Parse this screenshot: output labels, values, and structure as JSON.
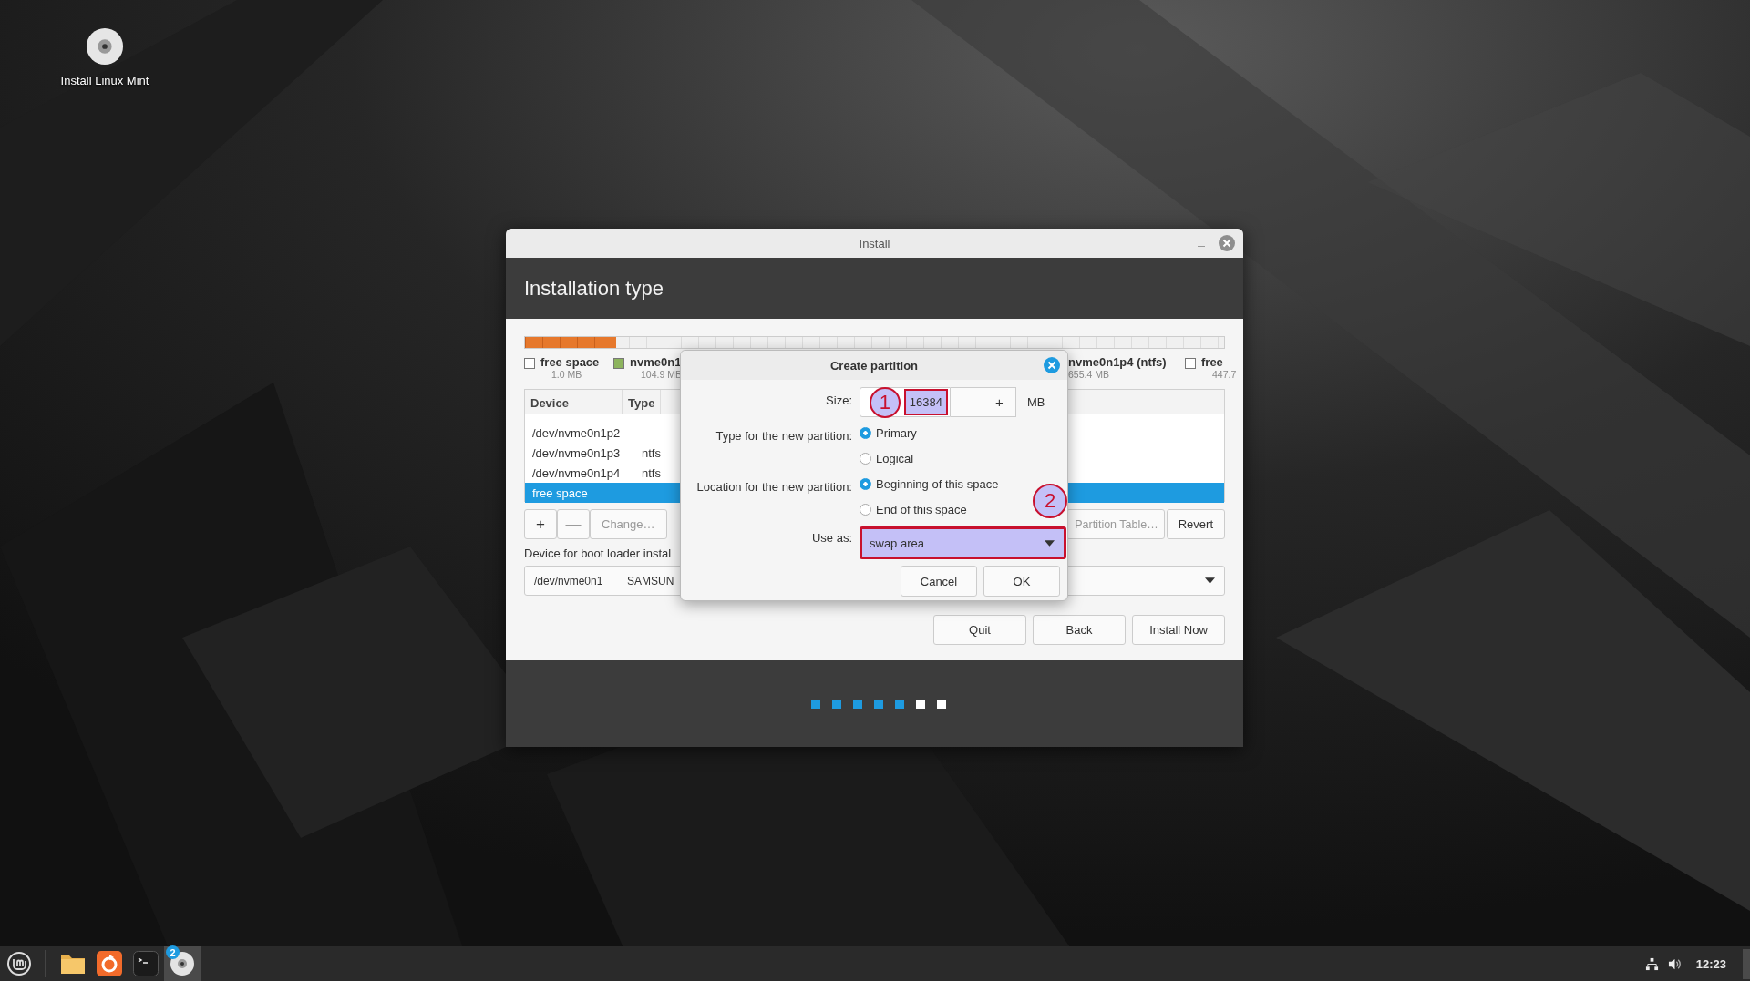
{
  "desktop_icons": [
    {
      "label": "Install Linux Mint"
    }
  ],
  "window": {
    "title": "Install",
    "heading": "Installation type",
    "disk_bar": {
      "level": 0.13
    },
    "legend": [
      {
        "name": "free space",
        "size": "1.0 MB",
        "color": "#ffffff"
      },
      {
        "name": "nvme0n1",
        "size": "104.9 MB",
        "color": "#8db45e"
      },
      {
        "name": "nvme0n1p4 (ntfs)",
        "size": "655.4 MB"
      },
      {
        "name": "free",
        "size": "447.7",
        "color": "#ffffff"
      }
    ],
    "table": {
      "columns": [
        "Device",
        "Type"
      ],
      "rows": [
        {
          "device": "/dev/nvme0n1p2",
          "selected": false
        },
        {
          "device": "/dev/nvme0n1p3",
          "type": "ntfs",
          "selected": false
        },
        {
          "device": "/dev/nvme0n1p4",
          "type": "ntfs",
          "selected": false
        },
        {
          "device": "free space",
          "selected": true
        }
      ]
    },
    "partition_buttons": [
      {
        "label": "+",
        "disabled": false
      },
      {
        "label": "—",
        "disabled": true
      },
      {
        "label": "Change…",
        "disabled": true
      }
    ],
    "right_buttons": [
      {
        "label": "Partition Table…",
        "disabled": true
      },
      {
        "label": "Revert",
        "disabled": false
      }
    ],
    "boot_loader": {
      "label": "Device for boot loader instal",
      "device": "/dev/nvme0n1",
      "model": "SAMSUN"
    },
    "buttons": [
      "Quit",
      "Back",
      "Install Now"
    ],
    "steps": [
      {
        "completed": true
      },
      {
        "completed": true
      },
      {
        "completed": true
      },
      {
        "completed": true
      },
      {
        "completed": true
      },
      {
        "completed": false
      },
      {
        "completed": false
      }
    ]
  },
  "dialog": {
    "title": "Create partition",
    "size": {
      "label": "Size:",
      "value": "16384",
      "unit": "MB",
      "minus": "—",
      "plus": "+",
      "annotation": "1",
      "highlighted": true
    },
    "type": {
      "label": "Type for the new partition:",
      "options": [
        {
          "label": "Primary",
          "selected": true
        },
        {
          "label": "Logical",
          "selected": false
        }
      ]
    },
    "location": {
      "label": "Location for the new partition:",
      "options": [
        {
          "label": "Beginning of this space",
          "selected": true
        },
        {
          "label": "End of this space",
          "selected": false
        }
      ]
    },
    "use_as": {
      "label": "Use as:",
      "value": "swap area",
      "annotation": "2",
      "highlighted": true
    },
    "buttons": [
      "Cancel",
      "OK"
    ]
  },
  "taskbar": {
    "apps": [
      {
        "kind": "folder",
        "active": false
      },
      {
        "kind": "browser",
        "active": false
      },
      {
        "kind": "terminal",
        "active": false
      },
      {
        "kind": "disc",
        "active": true,
        "badge": "2"
      }
    ],
    "clock": "12:23"
  }
}
